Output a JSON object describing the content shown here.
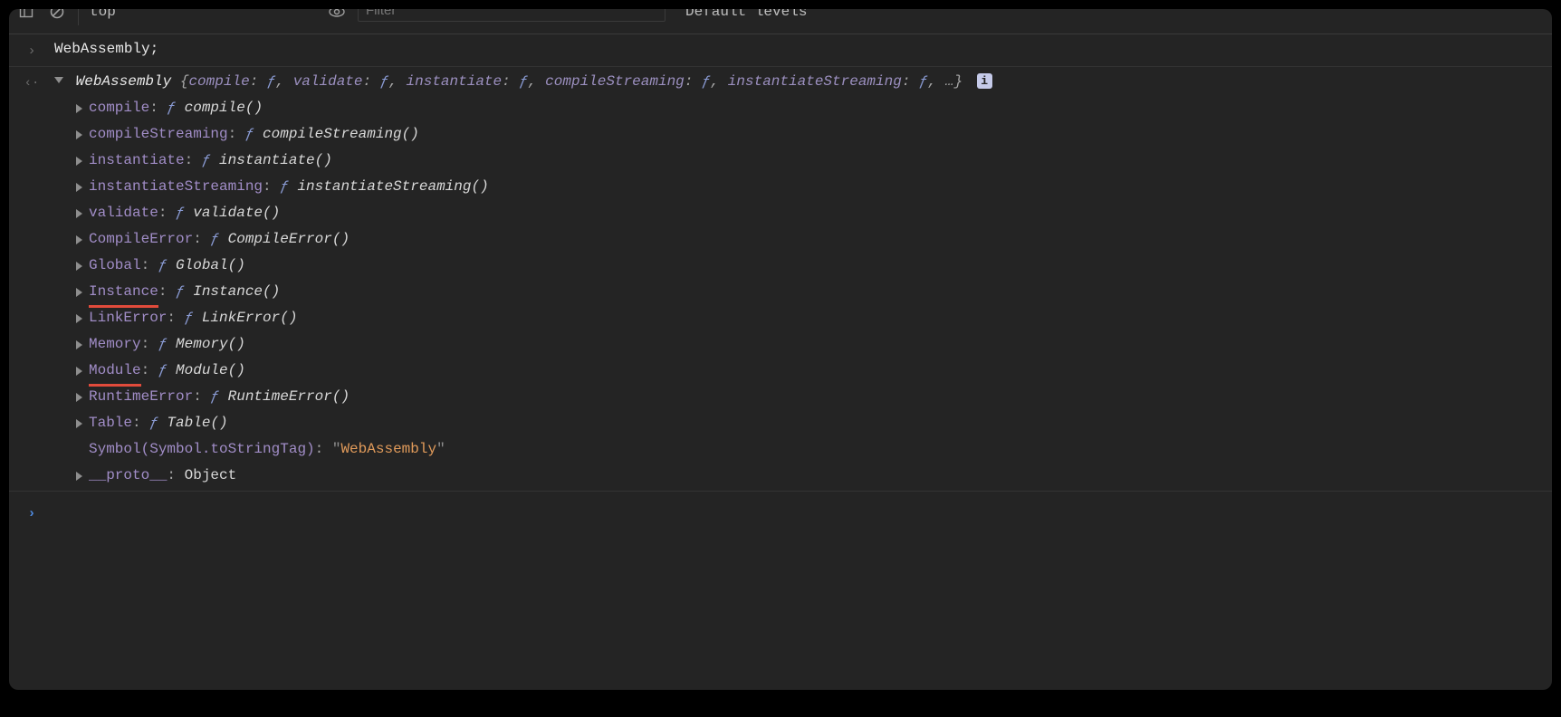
{
  "toolbar": {
    "context_label": "top",
    "filter_placeholder": "Filter",
    "levels_label": "Default levels"
  },
  "input": {
    "text": "WebAssembly;"
  },
  "result": {
    "object_name": "WebAssembly",
    "preview_keys": [
      {
        "k": "compile",
        "v": "ƒ"
      },
      {
        "k": "validate",
        "v": "ƒ"
      },
      {
        "k": "instantiate",
        "v": "ƒ"
      },
      {
        "k": "compileStreaming",
        "v": "ƒ"
      },
      {
        "k": "instantiateStreaming",
        "v": "ƒ"
      }
    ],
    "preview_trailing": ", …",
    "info_label": "i"
  },
  "properties": [
    {
      "key": "compile",
      "fn": "compile()",
      "type": "fn"
    },
    {
      "key": "compileStreaming",
      "fn": "compileStreaming()",
      "type": "fn"
    },
    {
      "key": "instantiate",
      "fn": "instantiate()",
      "type": "fn"
    },
    {
      "key": "instantiateStreaming",
      "fn": "instantiateStreaming()",
      "type": "fn"
    },
    {
      "key": "validate",
      "fn": "validate()",
      "type": "fn"
    },
    {
      "key": "CompileError",
      "fn": "CompileError()",
      "type": "fn"
    },
    {
      "key": "Global",
      "fn": "Global()",
      "type": "fn"
    },
    {
      "key": "Instance",
      "fn": "Instance()",
      "type": "fn",
      "underline": true
    },
    {
      "key": "LinkError",
      "fn": "LinkError()",
      "type": "fn"
    },
    {
      "key": "Memory",
      "fn": "Memory()",
      "type": "fn"
    },
    {
      "key": "Module",
      "fn": "Module()",
      "type": "fn",
      "underline": true
    },
    {
      "key": "RuntimeError",
      "fn": "RuntimeError()",
      "type": "fn"
    },
    {
      "key": "Table",
      "fn": "Table()",
      "type": "fn"
    },
    {
      "key": "Symbol(Symbol.toStringTag)",
      "str": "WebAssembly",
      "type": "str",
      "no_arrow": true
    },
    {
      "key": "__proto__",
      "plain": "Object",
      "type": "plain"
    }
  ],
  "glyphs": {
    "f": "ƒ",
    "input_prompt": "›",
    "output_prompt": "‹·"
  }
}
